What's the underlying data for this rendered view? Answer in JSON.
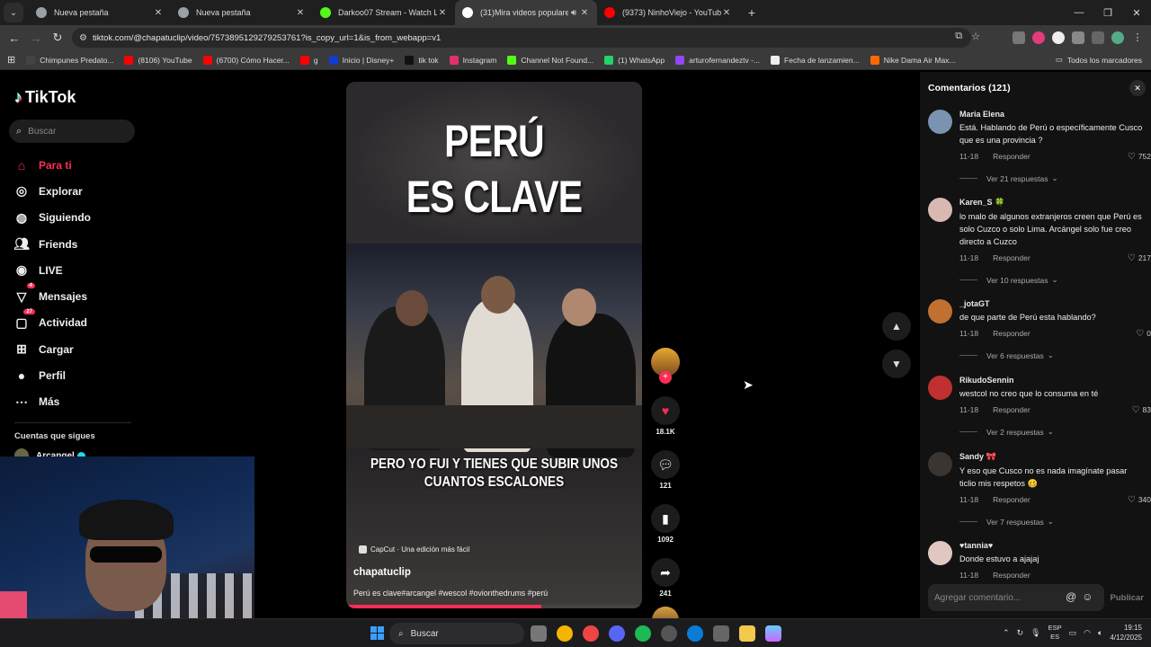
{
  "browser": {
    "tabs": [
      {
        "title": "Nueva pestaña",
        "color": "#9aa0a6"
      },
      {
        "title": "Nueva pestaña",
        "color": "#9aa0a6"
      },
      {
        "title": "Darkoo07 Stream - Watch Live",
        "color": "#53fc18"
      },
      {
        "title": "(31)Mira videos populares",
        "color": "#ffffff"
      },
      {
        "title": "(9373) NinhoViejo - YouTube",
        "color": "#ff0000"
      }
    ],
    "url": "tiktok.com/@chapatuclip/video/7573895129279253761?is_copy_url=1&is_from_webapp=v1",
    "bookmarks": [
      {
        "label": "Chimpunes Predato...",
        "color": "#444"
      },
      {
        "label": "(8106) YouTube",
        "color": "#ff0000"
      },
      {
        "label": "(6700) Cómo Hacer...",
        "color": "#ff0000"
      },
      {
        "label": "g",
        "color": "#ff0000"
      },
      {
        "label": "Inicio | Disney+",
        "color": "#113ccf"
      },
      {
        "label": "tik tok",
        "color": "#111"
      },
      {
        "label": "Instagram",
        "color": "#e1306c"
      },
      {
        "label": "Channel Not Found...",
        "color": "#53fc18"
      },
      {
        "label": "(1) WhatsApp",
        "color": "#25d366"
      },
      {
        "label": "arturofernandeztv -...",
        "color": "#9146ff"
      },
      {
        "label": "Fecha de lanzamien...",
        "color": "#eee"
      },
      {
        "label": "Nike Dama Air Max...",
        "color": "#ff6a00"
      }
    ],
    "all_bookmarks": "Todos los marcadores"
  },
  "sidebar": {
    "logo": "TikTok",
    "search_placeholder": "Buscar",
    "menu": [
      {
        "label": "Para ti",
        "icon": "home-icon",
        "active": true
      },
      {
        "label": "Explorar",
        "icon": "compass-icon"
      },
      {
        "label": "Siguiendo",
        "icon": "following-icon"
      },
      {
        "label": "Friends",
        "icon": "friends-icon"
      },
      {
        "label": "LIVE",
        "icon": "live-icon"
      },
      {
        "label": "Mensajes",
        "icon": "messages-icon",
        "badge": "4"
      },
      {
        "label": "Actividad",
        "icon": "activity-icon",
        "badge": "27"
      },
      {
        "label": "Cargar",
        "icon": "upload-icon"
      },
      {
        "label": "Perfil",
        "icon": "profile-icon"
      },
      {
        "label": "Más",
        "icon": "more-icon"
      }
    ],
    "following_title": "Cuentas que sigues",
    "following": [
      {
        "name": "Arcangel"
      }
    ]
  },
  "video": {
    "title_line1": "PERÚ",
    "title_line2": "ES CLAVE",
    "caption_line1": "PERO YO FUI Y TIENES QUE SUBIR UNOS",
    "caption_line2": "CUANTOS ESCALONES",
    "capcut": "CapCut · Una edición más fácil",
    "author": "chapatuclip",
    "description": "Perú es clave#arcangel #wescol #ovionthedrums #perú",
    "progress": 0.66,
    "likes": "18.1K",
    "comments": "121",
    "saves": "1092",
    "shares": "241"
  },
  "comments_panel": {
    "title": "Comentarios (121)",
    "input_placeholder": "Agregar comentario...",
    "publish": "Publicar",
    "items": [
      {
        "name": "Maria Elena",
        "text": "Está. Hablando de Perú o específicamente Cusco que es una provincia ?",
        "date": "11-18",
        "reply": "Responder",
        "likes": "752",
        "more": "Ver 21 respuestas",
        "avatar": "#7a93b0"
      },
      {
        "name": "Karen_S 🍀",
        "text": "lo malo de algunos extranjeros creen que Perú es solo Cuzco o solo Lima. Arcángel solo fue creo directo a Cuzco",
        "date": "11-18",
        "reply": "Responder",
        "likes": "217",
        "more": "Ver 10 respuestas",
        "avatar": "#d8b8b0"
      },
      {
        "name": "_jotaGT",
        "text": "de que parte de Perú esta hablando?",
        "date": "11-18",
        "reply": "Responder",
        "likes": "0",
        "more": "Ver 6 respuestas",
        "avatar": "#c07030"
      },
      {
        "name": "RikudoSennin",
        "text": "westcol no creo que lo consuma en té",
        "date": "11-18",
        "reply": "Responder",
        "likes": "83",
        "more": "Ver 2 respuestas",
        "avatar": "#c03030"
      },
      {
        "name": "Sandy 🎀",
        "text": "Y eso que Cusco no es nada imagínate pasar ticlio mis respetos 🥴",
        "date": "11-18",
        "reply": "Responder",
        "likes": "340",
        "more": "Ver 7 respuestas",
        "avatar": "#3a3530"
      },
      {
        "name": "♥tannia♥",
        "text": "Donde estuvo a ajajaj",
        "date": "11-18",
        "reply": "Responder",
        "likes": "",
        "more": "",
        "avatar": "#e0c8c0"
      }
    ]
  },
  "taskbar": {
    "search": "Buscar",
    "lang1": "ESP",
    "lang2": "ES",
    "time": "19:15",
    "date": "4/12/2025"
  }
}
